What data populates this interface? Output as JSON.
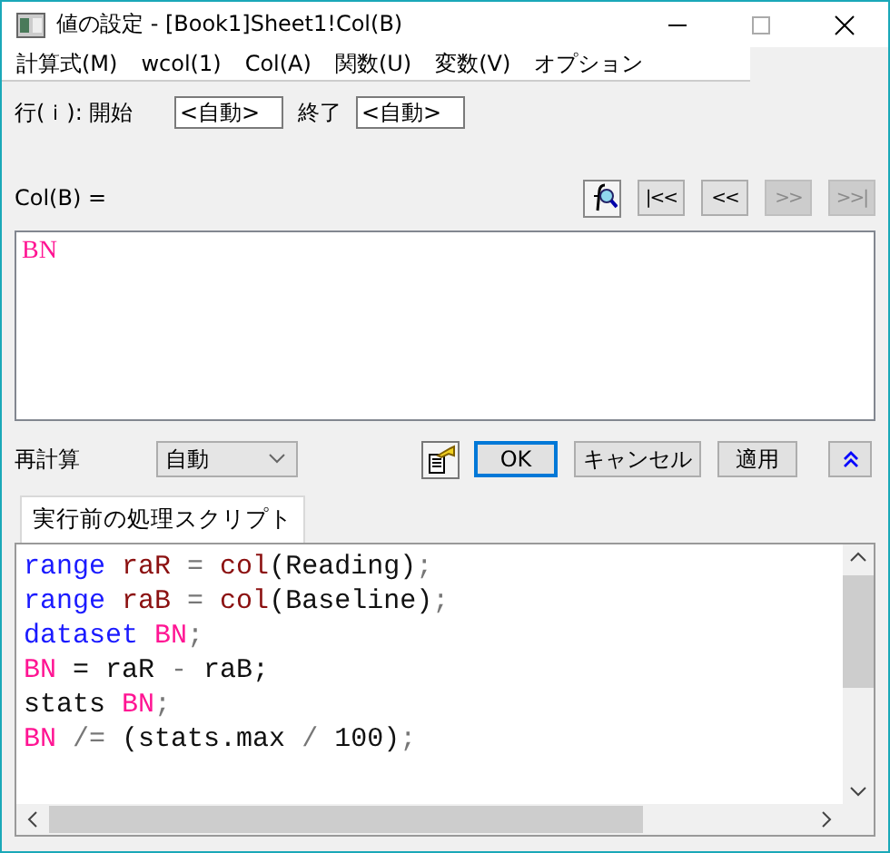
{
  "window": {
    "title": "値の設定 - [Book1]Sheet1!Col(B)"
  },
  "menu": [
    "計算式(M)",
    "wcol(1)",
    "Col(A)",
    "関数(U)",
    "変数(V)",
    "オプション"
  ],
  "row_range": {
    "label": "行(ｉ): 開始",
    "start": "<自動>",
    "end_label": "終了",
    "end": "<自動>"
  },
  "formula": {
    "label": "Col(B) =",
    "value": "BN",
    "nav_buttons": [
      {
        "label": "|<<",
        "disabled": false
      },
      {
        "label": "<<",
        "disabled": false
      },
      {
        "label": ">>",
        "disabled": true
      },
      {
        "label": ">>|",
        "disabled": true
      }
    ]
  },
  "recalc": {
    "label": "再計算",
    "value": "自動"
  },
  "buttons": [
    {
      "label": "OK",
      "kind": "default"
    },
    {
      "label": "キャンセル",
      "kind": "normal"
    },
    {
      "label": "適用",
      "kind": "normal"
    }
  ],
  "tabs": [
    {
      "label": "実行前の処理スクリプト",
      "selected": true
    }
  ],
  "script_lines": [
    [
      {
        "t": "range",
        "kind": "keyword"
      },
      {
        "t": " raR",
        "kind": "variable"
      },
      {
        "t": " =",
        "kind": "punct"
      },
      {
        "t": " col",
        "kind": "variable"
      },
      {
        "t": "(Reading)",
        "kind": "plain"
      },
      {
        "t": ";",
        "kind": "punct"
      }
    ],
    [
      {
        "t": "range",
        "kind": "keyword"
      },
      {
        "t": " raB",
        "kind": "variable"
      },
      {
        "t": " =",
        "kind": "punct"
      },
      {
        "t": " col",
        "kind": "variable"
      },
      {
        "t": "(Baseline)",
        "kind": "plain"
      },
      {
        "t": ";",
        "kind": "punct"
      }
    ],
    [
      {
        "t": "dataset",
        "kind": "keyword"
      },
      {
        "t": " BN",
        "kind": "dataset"
      },
      {
        "t": ";",
        "kind": "punct"
      }
    ],
    [
      {
        "t": "BN",
        "kind": "dataset"
      },
      {
        "t": " = raR ",
        "kind": "plain"
      },
      {
        "t": "-",
        "kind": "punct"
      },
      {
        "t": " raB;",
        "kind": "plain"
      }
    ],
    [
      {
        "t": "stats ",
        "kind": "plain"
      },
      {
        "t": "BN",
        "kind": "dataset"
      },
      {
        "t": ";",
        "kind": "punct"
      }
    ],
    [
      {
        "t": "BN",
        "kind": "dataset"
      },
      {
        "t": " /=",
        "kind": "punct"
      },
      {
        "t": " (stats.max ",
        "kind": "plain"
      },
      {
        "t": "/",
        "kind": "punct"
      },
      {
        "t": " 100)",
        "kind": "plain"
      },
      {
        "t": ";",
        "kind": "punct"
      }
    ]
  ]
}
